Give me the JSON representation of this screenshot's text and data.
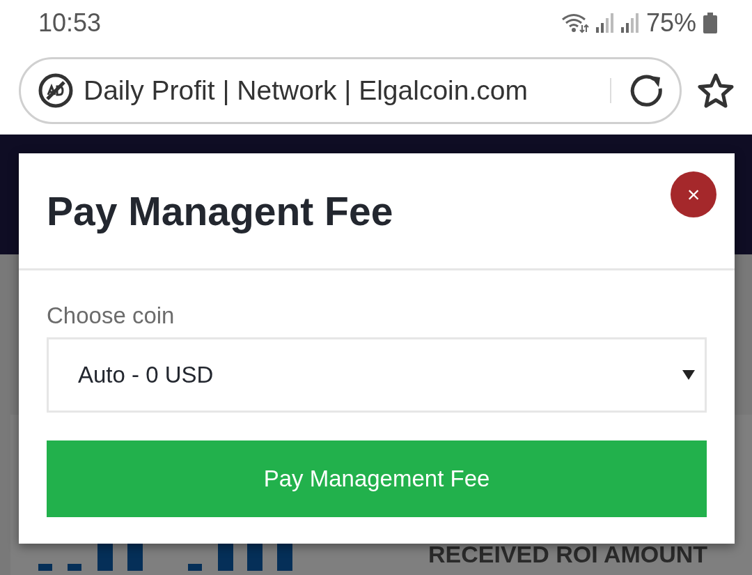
{
  "status_bar": {
    "time": "10:53",
    "battery": "75%"
  },
  "browser": {
    "page_title": "Daily Profit | Network | Elgalcoin.com"
  },
  "page": {
    "card_label": "RECEIVED ROI AMOUNT"
  },
  "modal": {
    "title": "Pay Managent Fee",
    "close": "×",
    "field_label": "Choose coin",
    "select_value": "Auto - 0 USD",
    "button": "Pay Management Fee"
  }
}
